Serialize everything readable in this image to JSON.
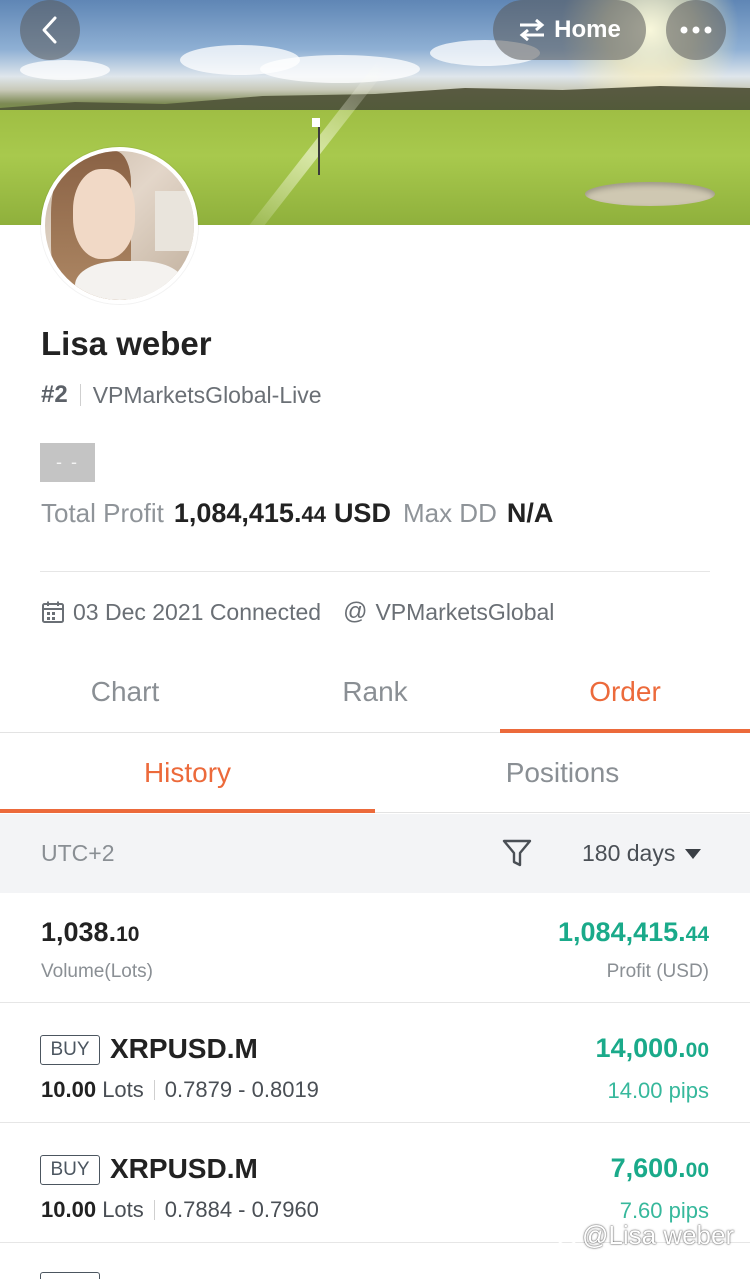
{
  "header": {
    "home_label": "Home"
  },
  "profile": {
    "name": "Lisa weber",
    "rank": "#2",
    "server": "VPMarketsGlobal-Live",
    "tag": "- -",
    "total_profit_label": "Total Profit",
    "total_profit_int": "1,084,415.",
    "total_profit_dec": "44",
    "total_profit_unit": "USD",
    "max_dd_label": "Max DD",
    "max_dd_value": "N/A",
    "connected": "03 Dec 2021 Connected",
    "broker": "VPMarketsGlobal"
  },
  "tabs": [
    {
      "label": "Chart",
      "active": false
    },
    {
      "label": "Rank",
      "active": false
    },
    {
      "label": "Order",
      "active": true
    }
  ],
  "subtabs": [
    {
      "label": "History",
      "active": true
    },
    {
      "label": "Positions",
      "active": false
    }
  ],
  "filter": {
    "timezone": "UTC+2",
    "period": "180 days"
  },
  "summary": {
    "volume_int": "1,038.",
    "volume_dec": "10",
    "volume_label": "Volume(Lots)",
    "profit_int": "1,084,415.",
    "profit_dec": "44",
    "profit_label": "Profit (USD)"
  },
  "orders": [
    {
      "side": "BUY",
      "symbol": "XRPUSD.M",
      "lots": "10.00",
      "lots_label": "Lots",
      "range": "0.7879 - 0.8019",
      "profit_int": "14,000.",
      "profit_dec": "00",
      "pips": "14.00 pips"
    },
    {
      "side": "BUY",
      "symbol": "XRPUSD.M",
      "lots": "10.00",
      "lots_label": "Lots",
      "range": "0.7884 - 0.7960",
      "profit_int": "7,600.",
      "profit_dec": "00",
      "pips": "7.60 pips"
    }
  ],
  "watermark": "@Lisa weber",
  "colors": {
    "accent": "#ec6a3b",
    "profit_green": "#1aaa8a",
    "muted": "#8a8f94"
  }
}
